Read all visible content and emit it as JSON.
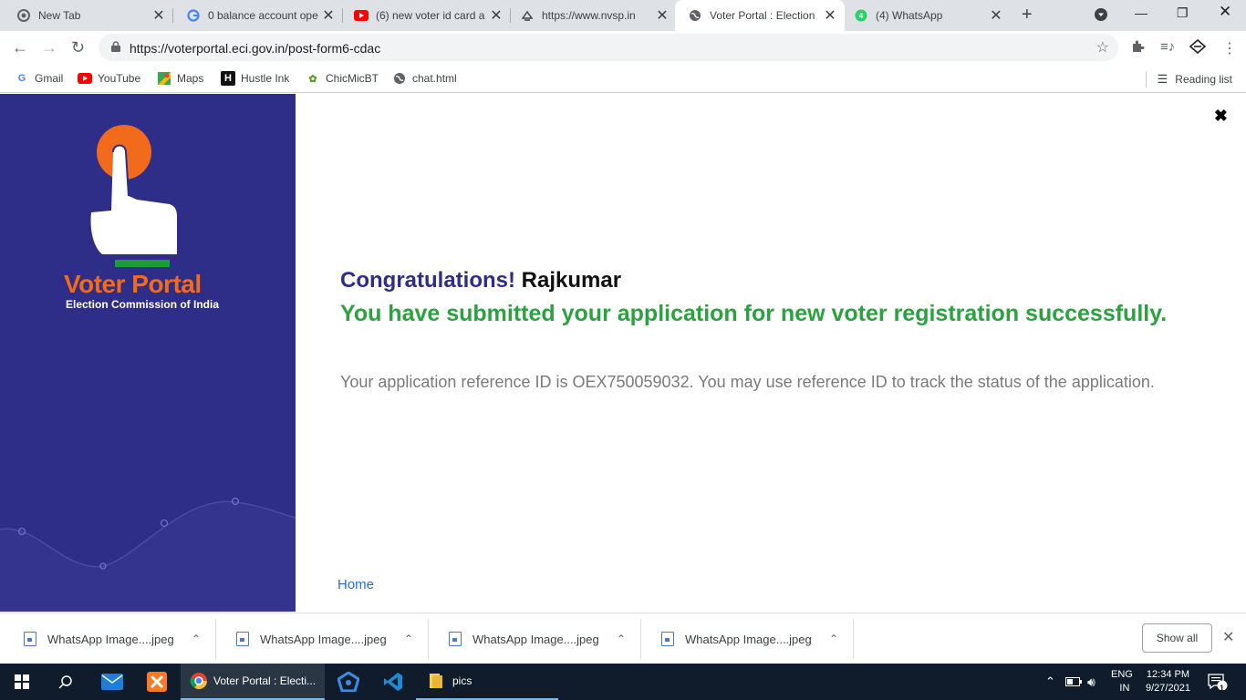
{
  "browser": {
    "tabs": [
      {
        "title": "New Tab",
        "icon": "chrome-icon"
      },
      {
        "title": "0 balance account ope",
        "icon": "google-icon"
      },
      {
        "title": "(6) new voter id card a",
        "icon": "youtube-icon"
      },
      {
        "title": "https://www.nvsp.in",
        "icon": "eci-icon"
      },
      {
        "title": "Voter Portal : Election",
        "icon": "globe-icon"
      },
      {
        "title": "(4) WhatsApp",
        "icon": "whatsapp-icon"
      }
    ],
    "url": "https://voterportal.eci.gov.in/post-form6-cdac",
    "bookmarks": [
      {
        "label": "Gmail"
      },
      {
        "label": "YouTube"
      },
      {
        "label": "Maps"
      },
      {
        "label": "Hustle Ink"
      },
      {
        "label": "ChicMicBT"
      },
      {
        "label": "chat.html"
      }
    ],
    "reading_list": "Reading list"
  },
  "sidebar": {
    "brand_title": "Voter Portal",
    "brand_subtitle": "Election Commission of India"
  },
  "main": {
    "congrats_label": "Congratulations!",
    "user_name": "Rajkumar",
    "success_message": "You have submitted your application for new voter registration successfully.",
    "reference_message": "Your application reference ID is OEX750059032. You may use reference ID to track the status of the application.",
    "home_link": "Home"
  },
  "downloads": {
    "items": [
      {
        "name": "WhatsApp Image....jpeg"
      },
      {
        "name": "WhatsApp Image....jpeg"
      },
      {
        "name": "WhatsApp Image....jpeg"
      },
      {
        "name": "WhatsApp Image....jpeg"
      }
    ],
    "show_all": "Show all"
  },
  "taskbar": {
    "chrome_label": "Voter Portal : Electi...",
    "folder_label": "pics",
    "lang_top": "ENG",
    "lang_bottom": "IN",
    "time": "12:34 PM",
    "date": "9/27/2021",
    "notification_count": "1"
  },
  "colors": {
    "sidebar_bg": "#2e2d87",
    "brand_orange": "#f26a1b",
    "success_green": "#2aa33f",
    "link_blue": "#2a6dd8"
  }
}
